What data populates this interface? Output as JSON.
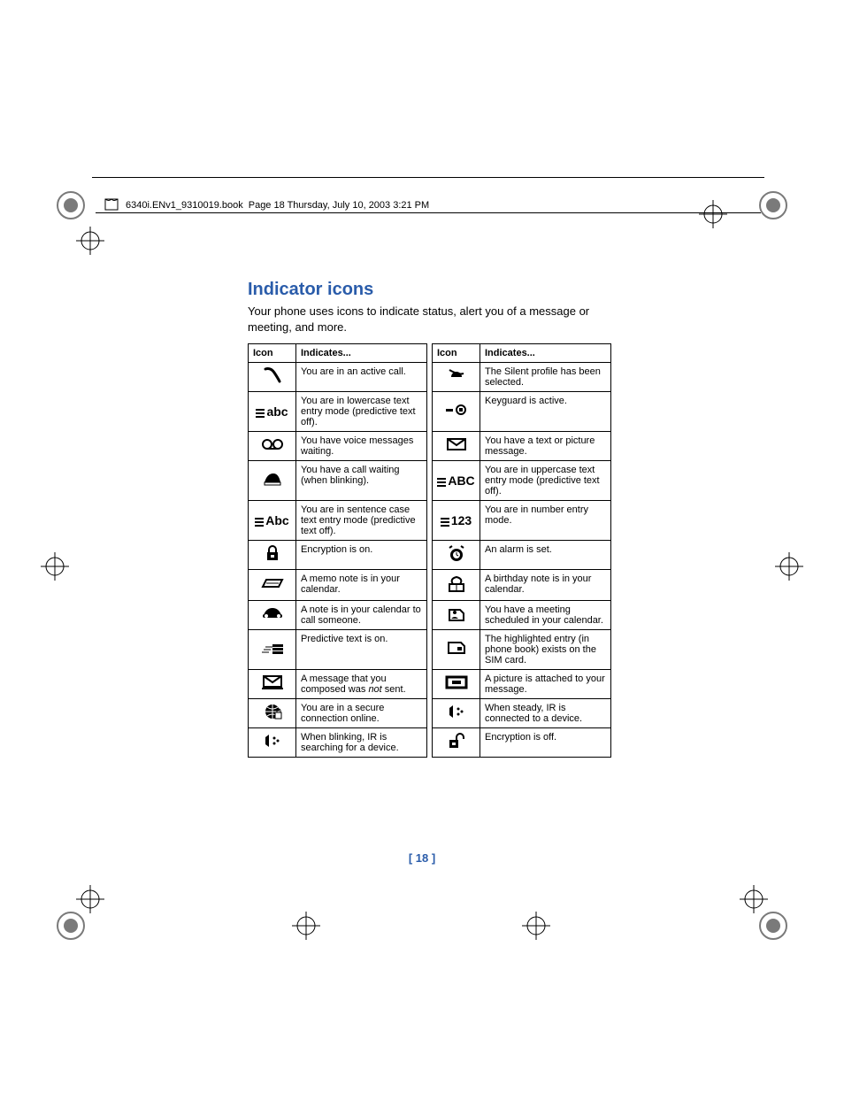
{
  "book_header": {
    "file": "6340i.ENv1_9310019.book",
    "page_meta": "Page 18  Thursday, July 10, 2003  3:21 PM"
  },
  "section_title": "Indicator icons",
  "intro": "Your phone uses icons to indicate status, alert you of a message or meeting, and more.",
  "headers": {
    "icon": "Icon",
    "indicates": "Indicates..."
  },
  "rows": [
    {
      "l": {
        "name": "active-call-icon",
        "desc": "You are in an active call."
      },
      "r": {
        "name": "silent-profile-icon",
        "desc": "The Silent profile has been selected."
      }
    },
    {
      "l": {
        "name": "lowercase-mode-icon",
        "glyph": "abc",
        "stripes": true,
        "desc": "You are in lowercase text entry mode (predictive text off)."
      },
      "r": {
        "name": "keyguard-icon",
        "desc": "Keyguard is active."
      }
    },
    {
      "l": {
        "name": "voicemail-icon",
        "desc": "You have voice messages waiting."
      },
      "r": {
        "name": "message-icon",
        "desc": "You have a text or picture message."
      }
    },
    {
      "l": {
        "name": "call-waiting-icon",
        "desc": "You have a call waiting (when blinking)."
      },
      "r": {
        "name": "uppercase-mode-icon",
        "glyph": "ABC",
        "stripes": true,
        "desc": "You are in uppercase text entry mode (predictive text off)."
      }
    },
    {
      "l": {
        "name": "sentence-case-icon",
        "glyph": "Abc",
        "stripes": true,
        "desc": "You are in sentence case text entry mode (predictive text off)."
      },
      "r": {
        "name": "number-mode-icon",
        "glyph": "123",
        "stripes": true,
        "desc": "You are in number entry mode."
      }
    },
    {
      "l": {
        "name": "encryption-on-icon",
        "desc": "Encryption is on."
      },
      "r": {
        "name": "alarm-set-icon",
        "desc": "An alarm is set."
      }
    },
    {
      "l": {
        "name": "memo-note-icon",
        "desc": "A memo note is in your calendar."
      },
      "r": {
        "name": "birthday-note-icon",
        "desc": "A birthday note is in your calendar."
      }
    },
    {
      "l": {
        "name": "call-note-icon",
        "desc": "A note is in your calendar to call someone."
      },
      "r": {
        "name": "meeting-icon",
        "desc": "You have a meeting scheduled in your calendar."
      }
    },
    {
      "l": {
        "name": "predictive-text-icon",
        "desc": "Predictive text is on."
      },
      "r": {
        "name": "sim-entry-icon",
        "desc": "The highlighted entry (in phone book) exists on the SIM card."
      }
    },
    {
      "l": {
        "name": "unsent-message-icon",
        "desc_html": "A message that you composed was <i>not</i> sent."
      },
      "r": {
        "name": "picture-attached-icon",
        "desc": "A picture is attached to your message."
      }
    },
    {
      "l": {
        "name": "secure-connection-icon",
        "desc": "You are in a secure connection online."
      },
      "r": {
        "name": "ir-connected-icon",
        "desc": "When steady, IR is connected to a device."
      }
    },
    {
      "l": {
        "name": "ir-searching-icon",
        "desc": "When blinking, IR is searching for a device."
      },
      "r": {
        "name": "encryption-off-icon",
        "desc": "Encryption is off."
      }
    }
  ],
  "page_number": "[ 18 ]"
}
